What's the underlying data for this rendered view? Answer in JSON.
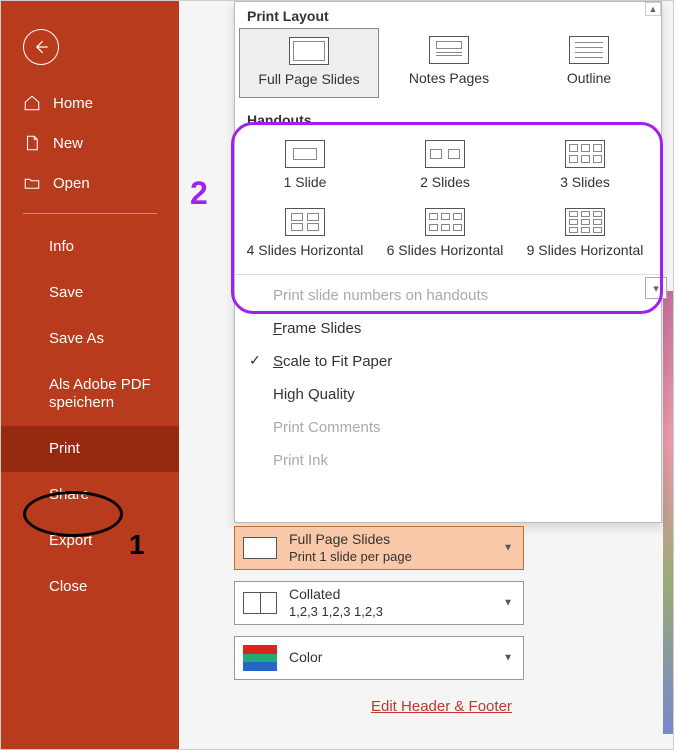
{
  "sidebar": {
    "back": "Back",
    "home": "Home",
    "new": "New",
    "open": "Open",
    "info": "Info",
    "save": "Save",
    "save_as": "Save As",
    "adobe": "Als Adobe PDF speichern",
    "print": "Print",
    "share": "Share",
    "export": "Export",
    "close": "Close"
  },
  "popup": {
    "print_layout_title": "Print Layout",
    "layouts": {
      "full_page": "Full Page Slides",
      "notes": "Notes Pages",
      "outline": "Outline"
    },
    "handouts_title": "Handouts",
    "handouts": {
      "h1": "1 Slide",
      "h2": "2 Slides",
      "h3": "3 Slides",
      "h4": "4 Slides Horizontal",
      "h6": "6 Slides Horizontal",
      "h9": "9 Slides Horizontal"
    },
    "options": {
      "print_numbers": "Print slide numbers on handouts",
      "frame": "Frame Slides",
      "scale": "Scale to Fit Paper",
      "hq": "High Quality",
      "comments": "Print Comments",
      "ink": "Print Ink"
    }
  },
  "controls": {
    "layout_dd_title": "Full Page Slides",
    "layout_dd_sub": "Print 1 slide per page",
    "collated_title": "Collated",
    "collated_sub": "1,2,3   1,2,3   1,2,3",
    "color_title": "Color"
  },
  "link_edit_hf": "Edit Header & Footer",
  "annotations": {
    "n1": "1",
    "n2": "2"
  },
  "colors": {
    "accent": "#B83B1D",
    "purple": "#a020f0"
  }
}
